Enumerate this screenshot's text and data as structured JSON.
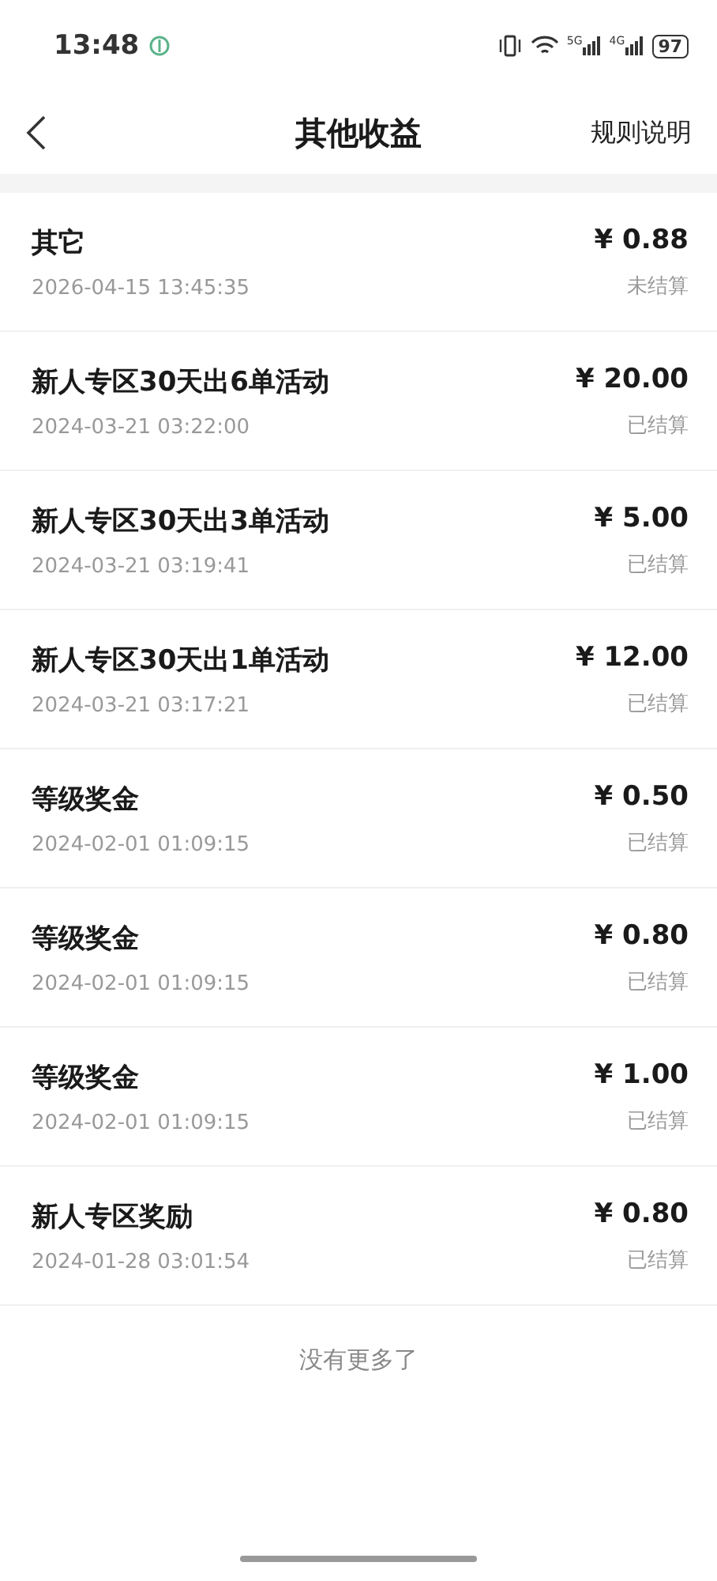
{
  "status_bar": {
    "time": "13:48",
    "network_1": "5G",
    "network_2": "4G",
    "battery": "97"
  },
  "nav": {
    "title": "其他收益",
    "action": "规则说明"
  },
  "records": [
    {
      "title": "其它",
      "time": "2026-04-15 13:45:35",
      "amount": "¥ 0.88",
      "status": "未结算"
    },
    {
      "title": "新人专区30天出6单活动",
      "time": "2024-03-21 03:22:00",
      "amount": "¥ 20.00",
      "status": "已结算"
    },
    {
      "title": "新人专区30天出3单活动",
      "time": "2024-03-21 03:19:41",
      "amount": "¥ 5.00",
      "status": "已结算"
    },
    {
      "title": "新人专区30天出1单活动",
      "time": "2024-03-21 03:17:21",
      "amount": "¥ 12.00",
      "status": "已结算"
    },
    {
      "title": "等级奖金",
      "time": "2024-02-01 01:09:15",
      "amount": "¥ 0.50",
      "status": "已结算"
    },
    {
      "title": "等级奖金",
      "time": "2024-02-01 01:09:15",
      "amount": "¥ 0.80",
      "status": "已结算"
    },
    {
      "title": "等级奖金",
      "time": "2024-02-01 01:09:15",
      "amount": "¥ 1.00",
      "status": "已结算"
    },
    {
      "title": "新人专区奖励",
      "time": "2024-01-28 03:01:54",
      "amount": "¥ 0.80",
      "status": "已结算"
    }
  ],
  "footer": "没有更多了"
}
